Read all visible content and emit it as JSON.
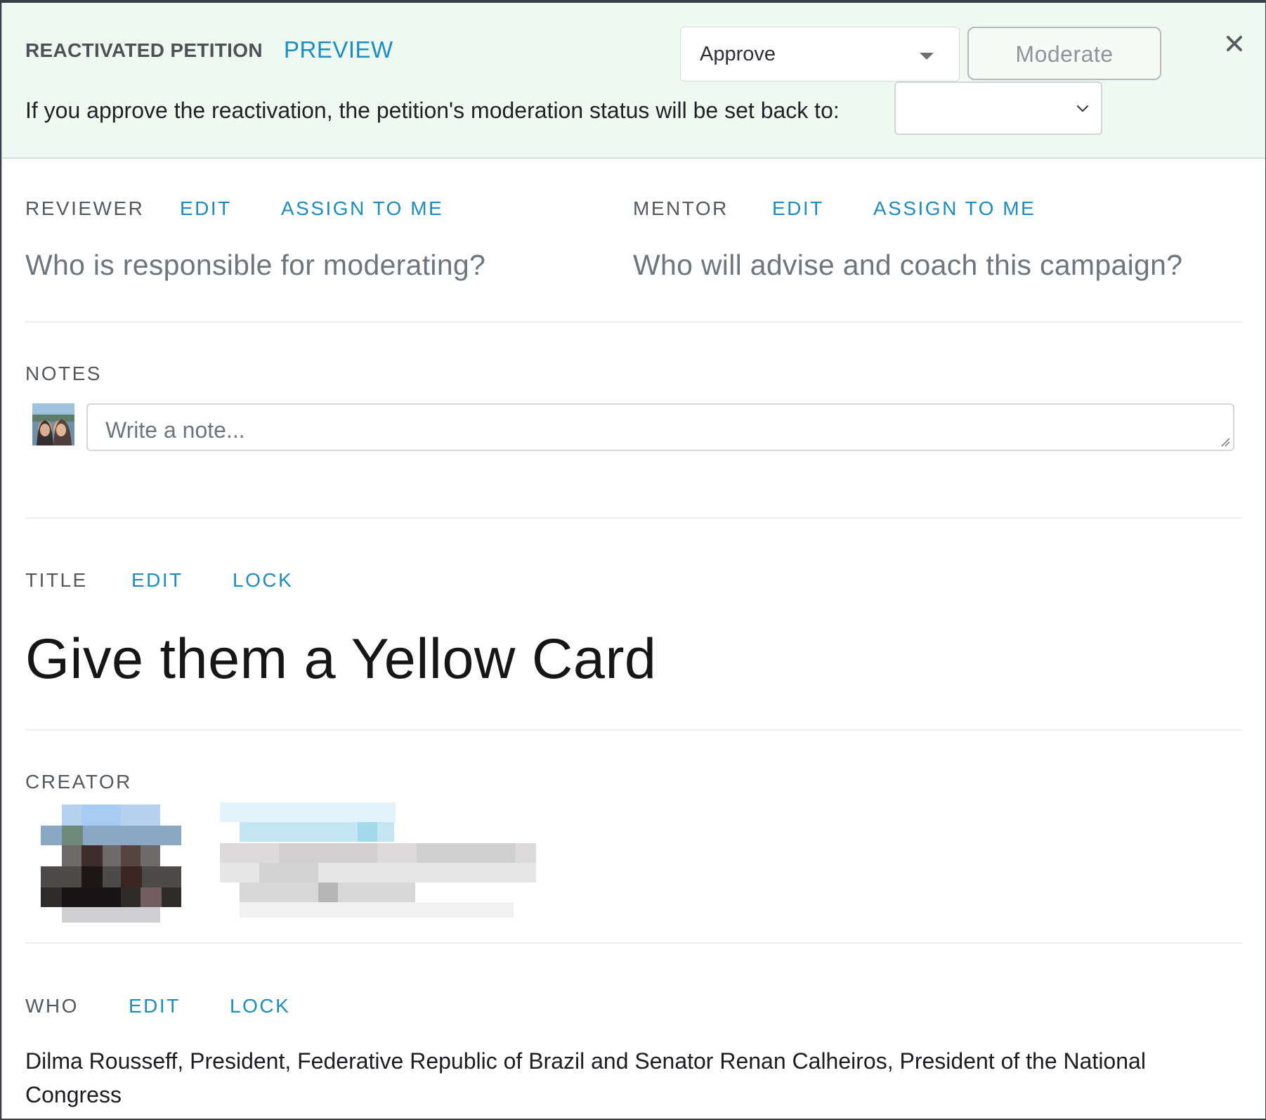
{
  "banner": {
    "title": "REACTIVATED PETITION",
    "preview_link": "PREVIEW",
    "decision_value": "Approve",
    "moderate_button": "Moderate",
    "message": "If you approve the reactivation, the petition's moderation status will be set back to:",
    "status_value": "",
    "background_color": "#eef9f1"
  },
  "reviewer": {
    "label": "REVIEWER",
    "edit": "EDIT",
    "assign": "ASSIGN TO ME",
    "placeholder": "Who is responsible for moderating?"
  },
  "mentor": {
    "label": "MENTOR",
    "edit": "EDIT",
    "assign": "ASSIGN TO ME",
    "placeholder": "Who will advise and coach this campaign?"
  },
  "notes": {
    "label": "NOTES",
    "placeholder": "Write a note..."
  },
  "title_section": {
    "label": "TITLE",
    "edit": "EDIT",
    "lock": "LOCK",
    "value": "Give them a Yellow Card"
  },
  "creator": {
    "label": "CREATOR"
  },
  "who": {
    "label": "WHO",
    "edit": "EDIT",
    "lock": "LOCK",
    "value": "Dilma Rousseff, President, Federative Republic of Brazil and Senator Renan Calheiros, President of the National Congress"
  },
  "colors": {
    "link": "#1b8dc3",
    "label": "#54595e",
    "placeholder": "#6e767d"
  }
}
